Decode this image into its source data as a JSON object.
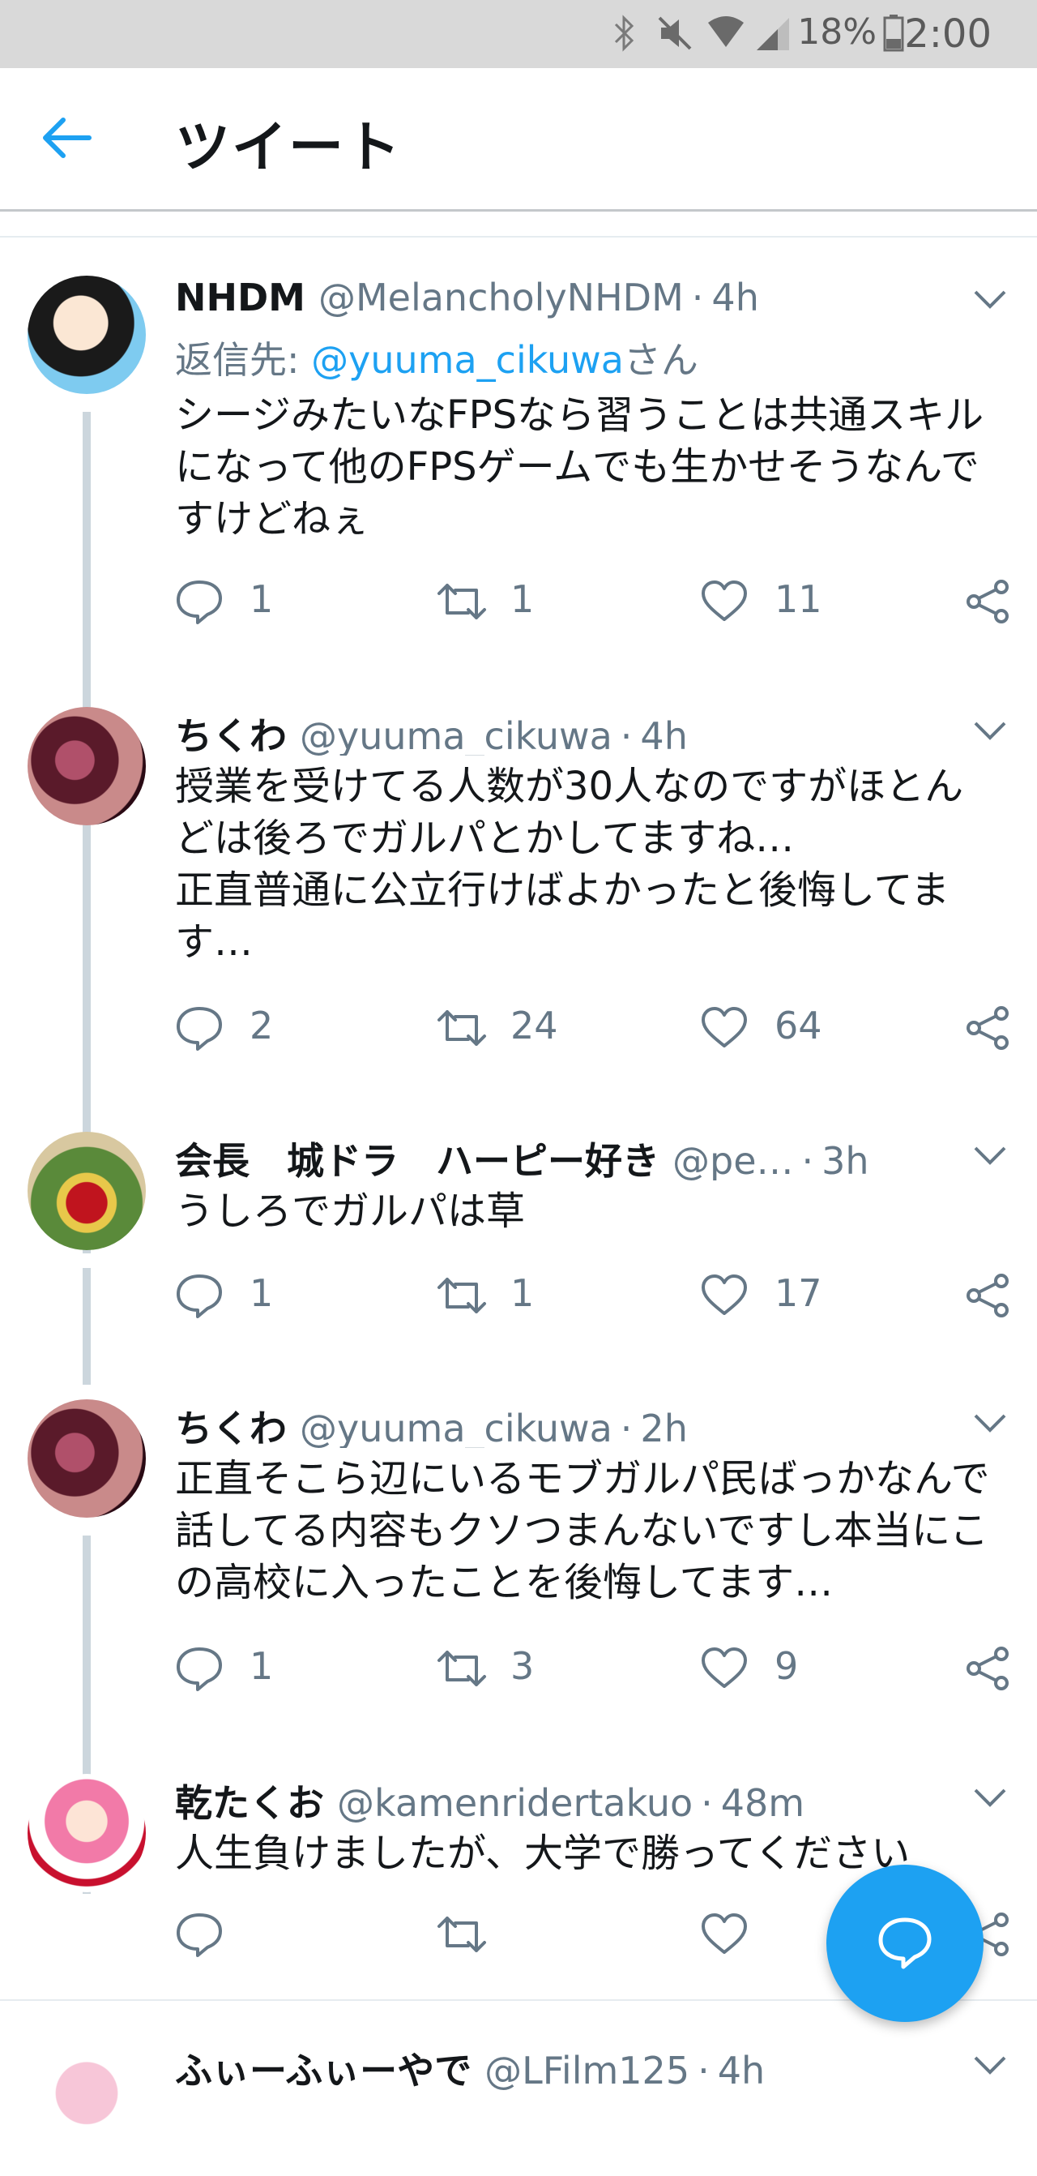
{
  "status_bar": {
    "battery_percent": "18%",
    "time": "2:00",
    "icons": [
      "bluetooth-icon",
      "mute-icon",
      "wifi-icon",
      "signal-icon",
      "battery-icon"
    ]
  },
  "header": {
    "title": "ツイート",
    "back_icon": "arrow-left-icon"
  },
  "colors": {
    "accent": "#1da1f2",
    "muted_text": "#657786",
    "thread_line": "#ccd6dd"
  },
  "tweets": [
    {
      "name": "NHDM",
      "handle": "@MelancholyNHDM",
      "time": "4h",
      "reply_prefix": "返信先: ",
      "reply_mention": "@yuuma_cikuwa",
      "reply_suffix": "さん",
      "text": "シージみたいなFPSなら習うことは共通スキルになって他のFPSゲームでも生かせそうなんですけどねぇ",
      "replies": "1",
      "retweets": "1",
      "likes": "11"
    },
    {
      "name": "ちくわ",
      "handle": "@yuuma_cikuwa",
      "time": "4h",
      "text": "授業を受けてる人数が30人なのですがほとんどは後ろでガルパとかしてますね…\n正直普通に公立行けばよかったと後悔してます…",
      "replies": "2",
      "retweets": "24",
      "likes": "64"
    },
    {
      "name": "会長　城ドラ　ハーピー好き",
      "handle": "@pe…",
      "time": "3h",
      "text": "うしろでガルパは草",
      "replies": "1",
      "retweets": "1",
      "likes": "17"
    },
    {
      "name": "ちくわ",
      "handle": "@yuuma_cikuwa",
      "time": "2h",
      "text": "正直そこら辺にいるモブガルパ民ばっかなんで話してる内容もクソつまんないですし本当にこの高校に入ったことを後悔してます…",
      "replies": "1",
      "retweets": "3",
      "likes": "9"
    },
    {
      "name": "乾たくお",
      "handle": "@kamenridertakuo",
      "time": "48m",
      "text": "人生負けましたが、大学で勝ってください",
      "replies": "",
      "retweets": "",
      "likes": ""
    },
    {
      "name": "ふぃーふぃーやで",
      "handle": "@LFilm125",
      "time": "4h"
    }
  ],
  "fab": {
    "icon": "compose-reply-icon"
  }
}
